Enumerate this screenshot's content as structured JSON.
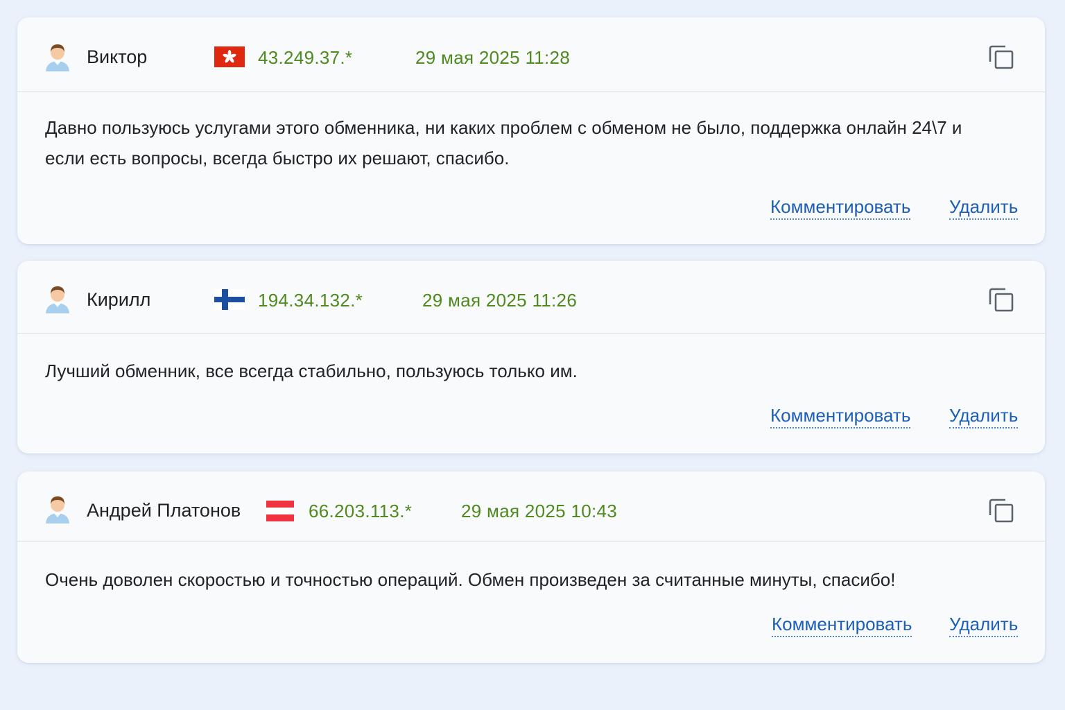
{
  "actions": {
    "comment_label": "Комментировать",
    "delete_label": "Удалить"
  },
  "reviews": [
    {
      "author": "Виктор",
      "flag": "hong-kong-flag",
      "ip": "43.249.37.*",
      "date": "29 мая 2025 11:28",
      "text": "Давно пользуюсь услугами этого обменника, ни каких проблем с обменом не было, поддержка онлайн 24\\7 и если есть вопросы, всегда быстро их решают, спасибо."
    },
    {
      "author": "Кирилл",
      "flag": "finland-flag",
      "ip": "194.34.132.*",
      "date": "29 мая 2025 11:26",
      "text": "Лучший обменник, все всегда стабильно, пользуюсь только им."
    },
    {
      "author": "Андрей Платонов",
      "flag": "austria-flag",
      "ip": "66.203.113.*",
      "date": "29 мая 2025 10:43",
      "text": "Очень доволен скоростью и точностью операций. Обмен произведен за считанные минуты, спасибо!"
    }
  ],
  "colors": {
    "accent_link": "#1d5fb6",
    "meta_green": "#4f8a1f",
    "background": "#eaf1fb"
  }
}
